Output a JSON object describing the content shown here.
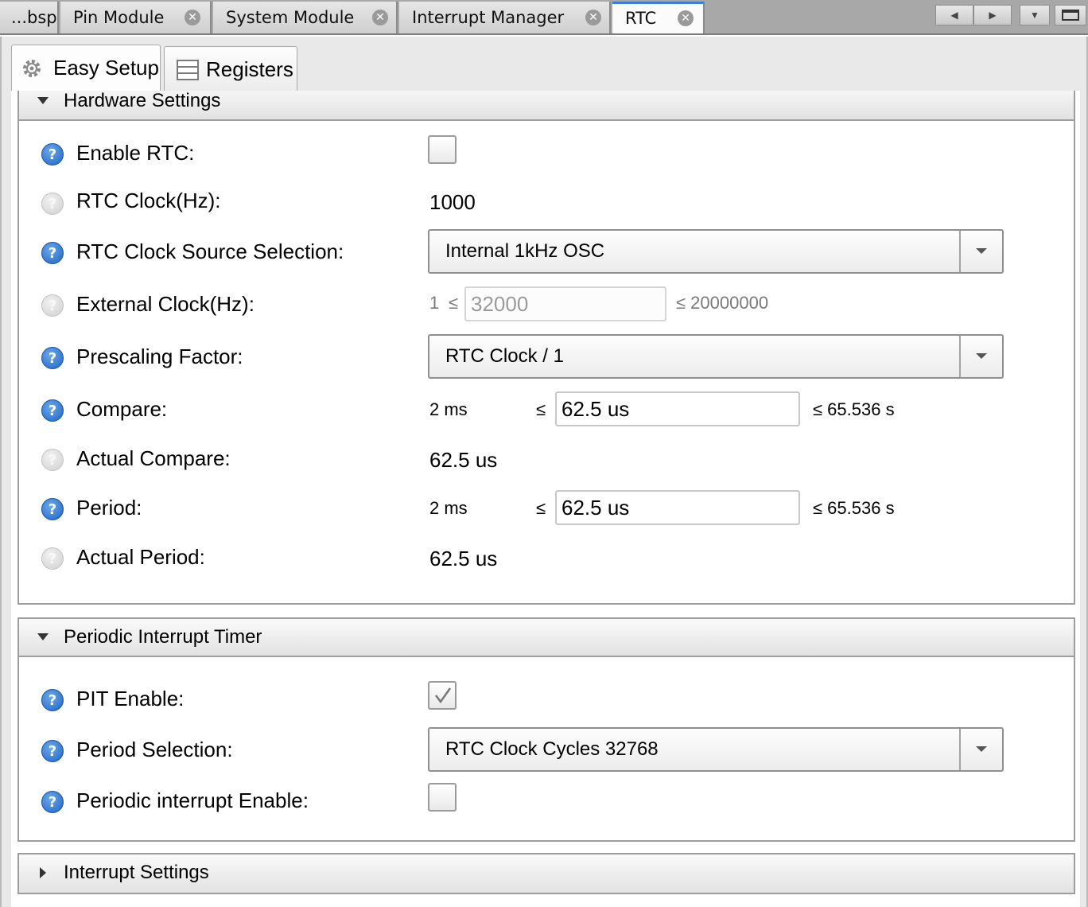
{
  "doc_tabs": [
    {
      "label": "...bsp",
      "closable": false,
      "active": false
    },
    {
      "label": "Pin Module",
      "closable": true,
      "active": false
    },
    {
      "label": "System Module",
      "closable": true,
      "active": false
    },
    {
      "label": "Interrupt Manager",
      "closable": true,
      "active": false
    },
    {
      "label": "RTC",
      "closable": true,
      "active": true
    }
  ],
  "sub_tabs": [
    {
      "label": "Easy Setup",
      "icon": "gear-icon",
      "active": true
    },
    {
      "label": "Registers",
      "icon": "registers-icon",
      "active": false
    }
  ],
  "hardware": {
    "title": "Hardware Settings",
    "enable_rtc": {
      "label": "Enable RTC:",
      "checked": false
    },
    "rtc_clock": {
      "label": "RTC Clock(Hz):",
      "value": "1000"
    },
    "clock_source": {
      "label": "RTC Clock Source Selection:",
      "value": "Internal 1kHz OSC"
    },
    "external_clock": {
      "label": "External Clock(Hz):",
      "min": "1",
      "le": "≤",
      "value": "32000",
      "max": "≤ 20000000"
    },
    "prescaling": {
      "label": "Prescaling Factor:",
      "value": "RTC Clock / 1"
    },
    "compare": {
      "label": "Compare:",
      "min": "2 ms",
      "le": "≤",
      "value": "62.5 us",
      "max": "≤ 65.536 s"
    },
    "actual_compare": {
      "label": "Actual Compare:",
      "value": "62.5 us"
    },
    "period": {
      "label": "Period:",
      "min": "2 ms",
      "le": "≤",
      "value": "62.5 us",
      "max": "≤ 65.536 s"
    },
    "actual_period": {
      "label": "Actual Period:",
      "value": "62.5 us"
    }
  },
  "pit": {
    "title": "Periodic Interrupt Timer",
    "pit_enable": {
      "label": "PIT Enable:",
      "checked": true
    },
    "period_selection": {
      "label": "Period Selection:",
      "value": "RTC Clock Cycles 32768"
    },
    "periodic_interrupt_enable": {
      "label": "Periodic interrupt Enable:",
      "checked": false
    }
  },
  "interrupt": {
    "title": "Interrupt Settings"
  },
  "help_glyph": "?",
  "close_glyph": "✕",
  "colors": {
    "active_tab_accent": "#3b7fd6",
    "help_active": "#1f63bf",
    "help_inactive": "#cfcfcf"
  }
}
